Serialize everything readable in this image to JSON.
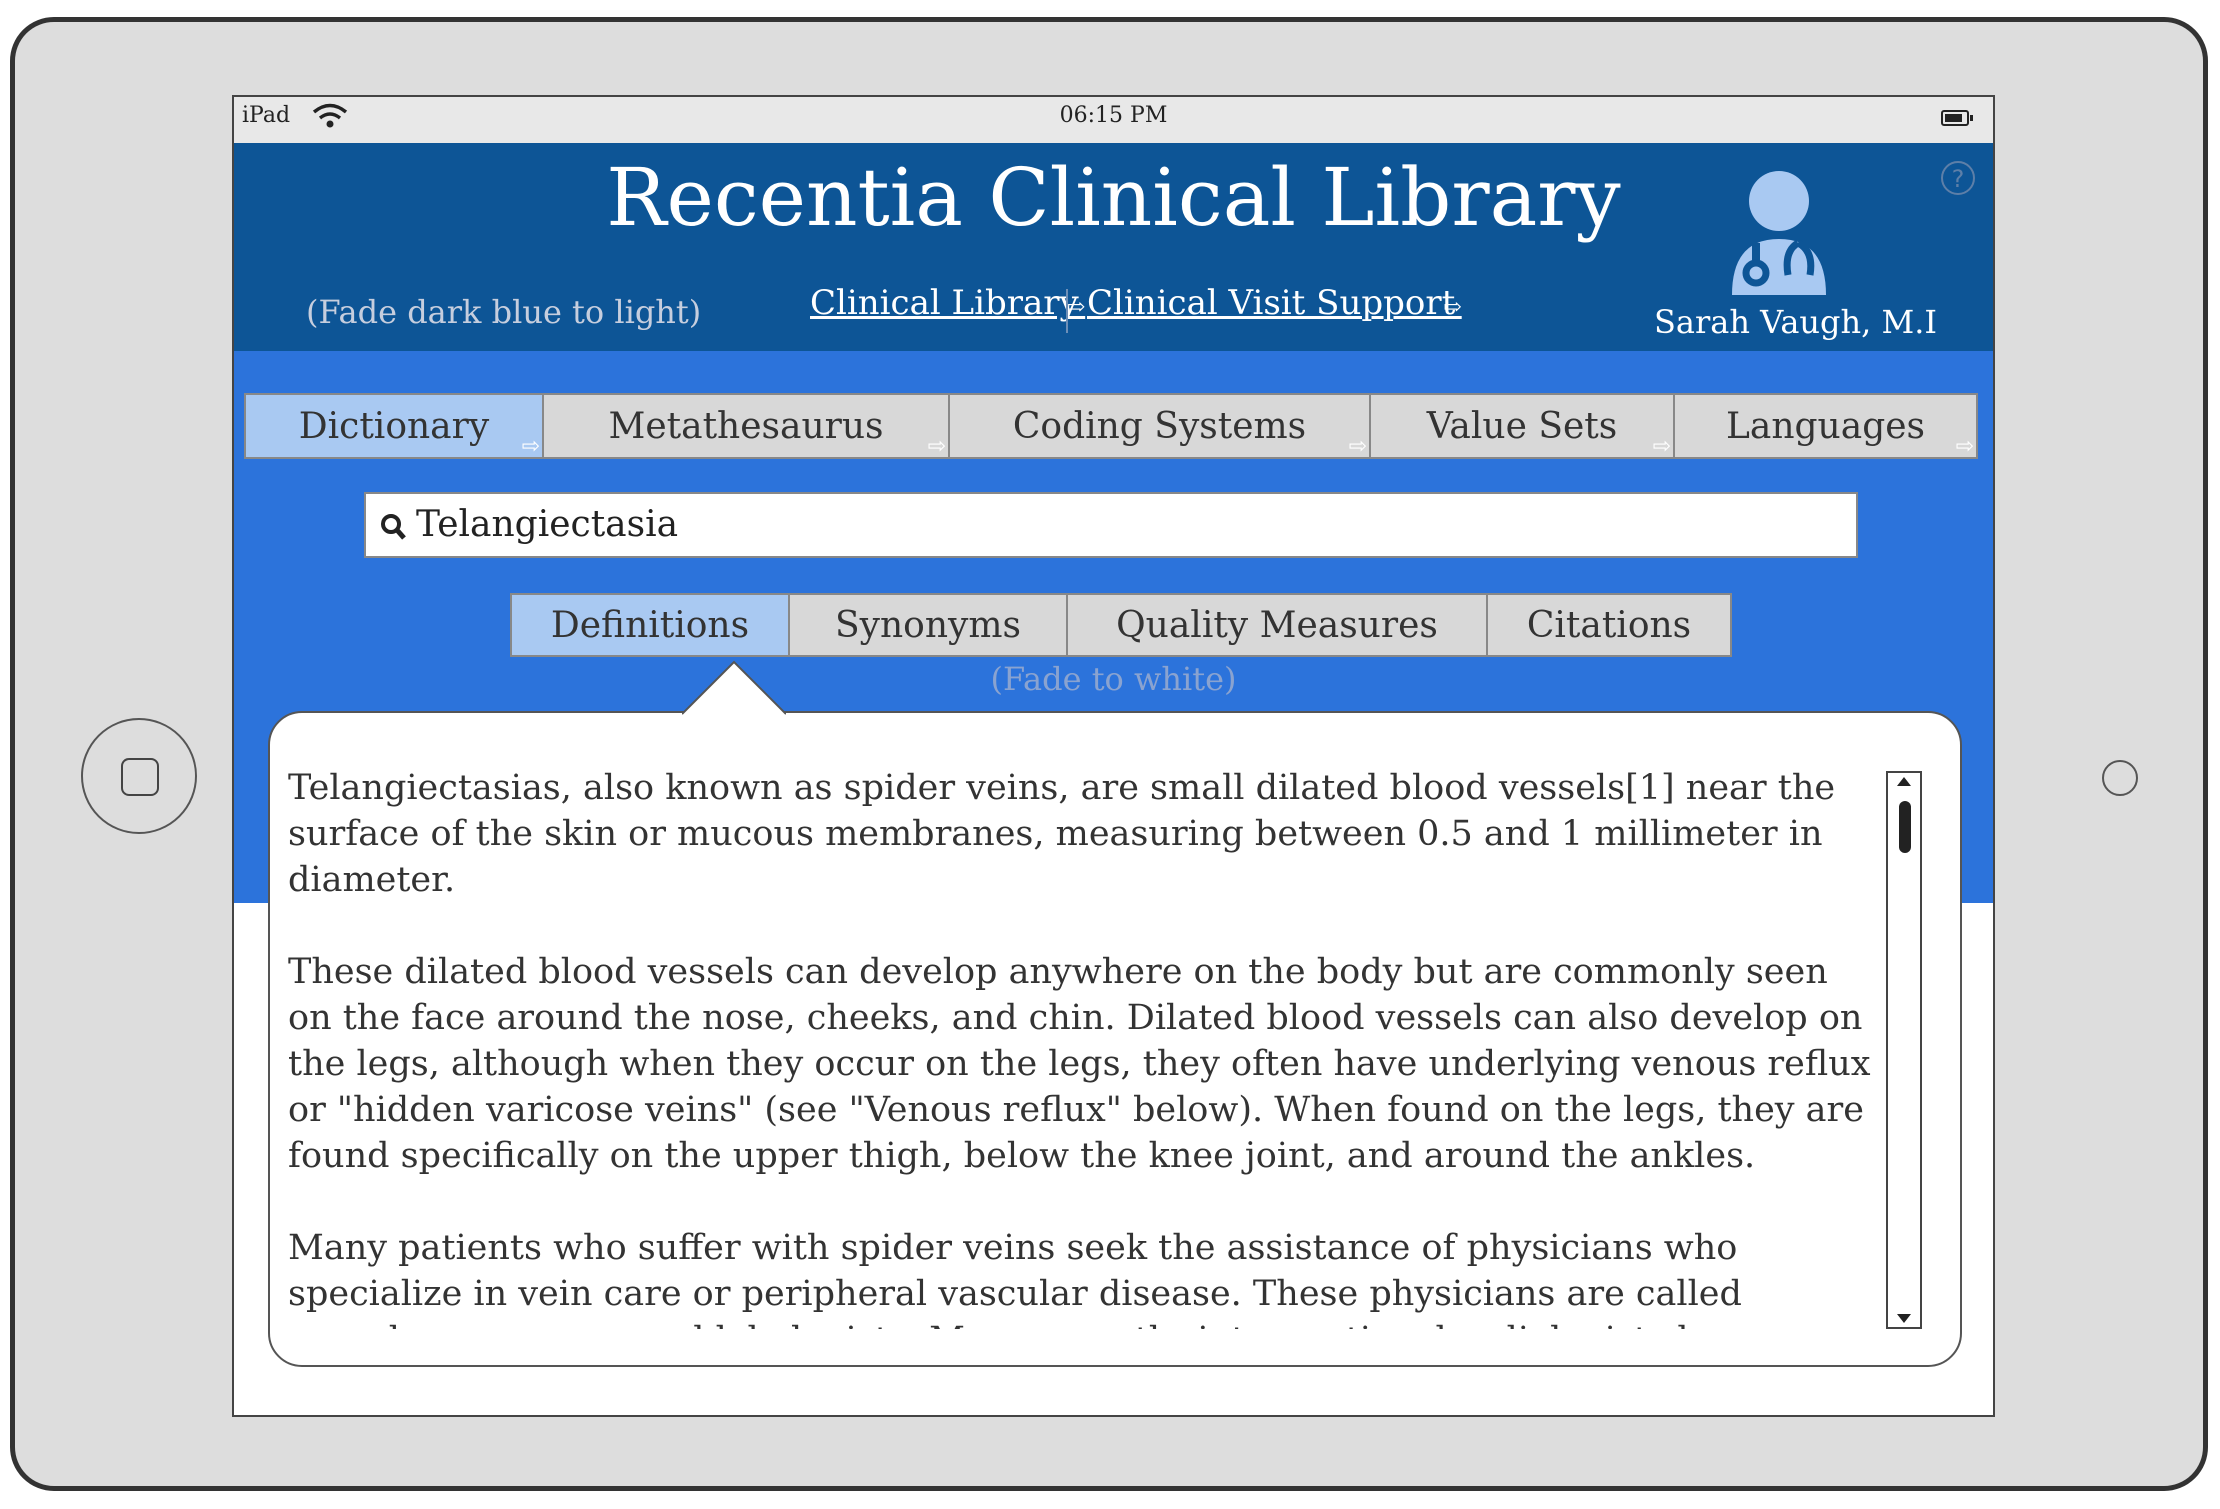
{
  "status_bar": {
    "carrier": "iPad",
    "time": "06:15 PM"
  },
  "header": {
    "title": "Recentia Clinical Library",
    "fade_note": "(Fade dark blue to light)",
    "links": [
      "Clinical Library",
      "Clinical Visit Support"
    ],
    "user_name": "Sarah Vaugh, M.I",
    "help_symbol": "?"
  },
  "main_tabs": [
    "Dictionary",
    "Metathesaurus",
    "Coding Systems",
    "Value Sets",
    "Languages"
  ],
  "main_tabs_active": "Dictionary",
  "search": {
    "value": "Telangiectasia"
  },
  "sub_tabs": [
    "Definitions",
    "Synonyms",
    "Quality Measures",
    "Citations"
  ],
  "sub_tabs_active": "Definitions",
  "fade_note_2": "(Fade to white)",
  "definition": {
    "paragraphs": [
      "Telangiectasias, also known as spider veins, are small dilated blood vessels[1] near the surface of the skin or mucous membranes, measuring between 0.5 and 1 millimeter in diameter.",
      "These dilated blood vessels can develop anywhere on the body but are commonly seen on the face around the nose, cheeks, and chin. Dilated blood vessels can also develop on the legs, although when they occur on the legs, they often have underlying venous reflux or \"hidden varicose veins\" (see \"Venous reflux\" below). When found on the legs, they are found specifically on the upper thigh, below the knee joint, and around the ankles.",
      "Many patients who suffer with spider veins seek the assistance of physicians who specialize in vein care or peripheral vascular disease. These physicians are called vascular surgeons or phlebologists. More recently, interventional radiologists have started treating venous"
    ]
  },
  "icons": {
    "wifi": "wifi-icon",
    "battery": "battery-icon",
    "help": "help-icon",
    "avatar": "doctor-avatar-icon",
    "search": "search-icon",
    "tab_arrow": "arrow-right-icon"
  },
  "colors": {
    "header_bg": "#0d5596",
    "band_bg": "#2c73db",
    "active_tab": "#a9c9f2",
    "inactive_tab": "#d8d8d8",
    "avatar": "#a9c9f2"
  }
}
